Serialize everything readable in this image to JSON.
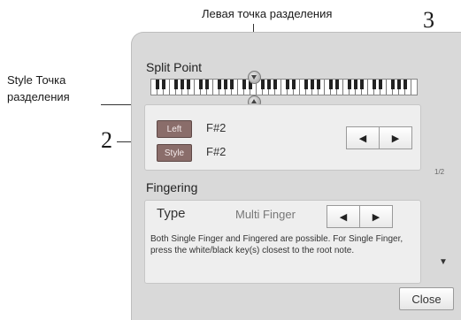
{
  "annotations": {
    "left_split_point": "Левая точка разделения",
    "style_split_point_line1": "Style Точка",
    "style_split_point_line2": "разделения",
    "callout_2": "2",
    "callout_3": "3"
  },
  "split_point": {
    "title": "Split Point",
    "left_button": "Left",
    "left_value": "F#2",
    "style_button": "Style",
    "style_value": "F#2",
    "prev_symbol": "◀",
    "next_symbol": "▶",
    "page_indicator": "1/2"
  },
  "fingering": {
    "title": "Fingering",
    "type_label": "Type",
    "type_value": "Multi Finger",
    "prev_symbol": "◀",
    "next_symbol": "▶",
    "description": "Both Single Finger and Fingered are possible. For Single Finger, press the white/black key(s) closest to the root note."
  },
  "scroll_down_symbol": "▼",
  "close_label": "Close",
  "colors": {
    "panel_bg": "#d9d9d9",
    "inner_box_bg": "#eeeeee",
    "active_button": "#8a6d6a"
  }
}
